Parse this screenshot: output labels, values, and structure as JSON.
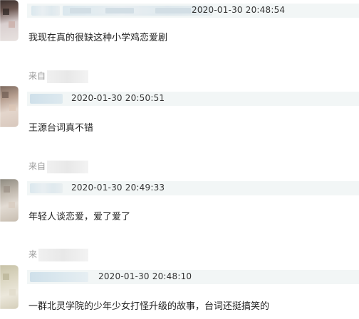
{
  "comments": [
    {
      "timestamp": "2020-01-30 20:48:54",
      "text": "我现在真的很缺这种小学鸡恋爱剧",
      "source": ""
    },
    {
      "timestamp": "2020-01-30 20:50:51",
      "text": "王源台词真不错",
      "source": "来自"
    },
    {
      "timestamp": "2020-01-30 20:49:33",
      "text": "年轻人谈恋爱，爱了爱了",
      "source": "来自"
    },
    {
      "timestamp": "2020-01-30 20:48:10",
      "text": "一群北灵学院的少年少女打怪升级的故事，台词还挺搞笑的",
      "source": "来"
    }
  ],
  "colors": {
    "meta_bar": "#f2f6f6",
    "text": "#222222",
    "source_text": "#9a9a9a"
  }
}
